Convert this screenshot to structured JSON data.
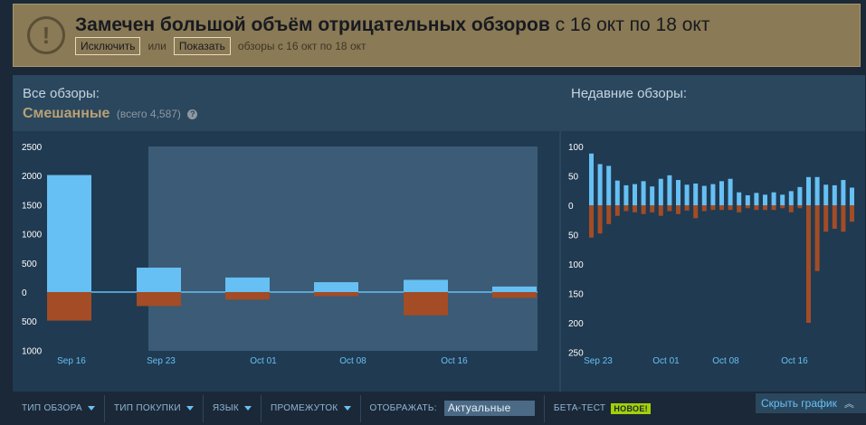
{
  "alert": {
    "title": "Замечен большой объём отрицательных обзоров",
    "dates": "с 16 окт по 18 окт",
    "exclude_label": "Исключить",
    "or_label": "или",
    "show_label": "Показать",
    "desc": "обзоры с 16 окт по 18 окт",
    "icon": "exclamation-icon"
  },
  "all_reviews": {
    "label": "Все обзоры:",
    "summary": "Смешанные",
    "total": "(всего 4,587)"
  },
  "recent_reviews": {
    "label": "Недавние обзоры:"
  },
  "colors": {
    "positive": "#66c0f4",
    "negative": "#a34c25",
    "summary": "#b9a074",
    "beta": "#a4d007"
  },
  "chart_data": [
    {
      "type": "bar",
      "name": "all-reviews",
      "y_ticks": [
        "2500",
        "2000",
        "1500",
        "1000",
        "500",
        "0",
        "500",
        "1000"
      ],
      "x_tick_labels": [
        "Sep 16",
        "Sep 23",
        "Oct 01",
        "Oct 08",
        "Oct 16"
      ],
      "categories": [
        "Sep 16",
        "Sep 23",
        "Oct 01",
        "Oct 08",
        "Oct 16",
        ""
      ],
      "series": [
        {
          "values": [
            2010,
            420,
            250,
            170,
            210,
            95
          ]
        },
        {
          "values": [
            -490,
            -240,
            -130,
            -70,
            -400,
            -100
          ]
        }
      ],
      "ylim": [
        -1000,
        2500
      ]
    },
    {
      "type": "bar",
      "name": "recent-reviews",
      "y_ticks": [
        "100",
        "50",
        "0",
        "50",
        "100",
        "150",
        "200",
        "250"
      ],
      "x_tick_labels": [
        "Sep 23",
        "Oct 01",
        "Oct 08",
        "Oct 16"
      ],
      "series": [
        {
          "values": [
            88,
            70,
            67,
            42,
            34,
            36,
            41,
            32,
            45,
            51,
            43,
            35,
            37,
            33,
            36,
            41,
            45,
            22,
            17,
            21,
            18,
            22,
            18,
            24,
            31,
            48,
            48,
            35,
            34,
            43,
            30
          ]
        },
        {
          "values": [
            -55,
            -48,
            -32,
            -18,
            -10,
            -12,
            -15,
            -12,
            -18,
            -10,
            -15,
            -9,
            -22,
            -10,
            -8,
            -8,
            -8,
            -12,
            -5,
            -8,
            -8,
            -8,
            -5,
            -12,
            -5,
            -200,
            -112,
            -45,
            -40,
            -45,
            -28
          ]
        }
      ],
      "ylim": [
        -250,
        100
      ]
    }
  ],
  "filters": {
    "review_type": "ТИП ОБЗОРА",
    "purchase_type": "ТИП ПОКУПКИ",
    "language": "ЯЗЫК",
    "period": "ПРОМЕЖУТОК",
    "display_label": "ОТОБРАЖАТЬ:",
    "display_value": "Актуальные",
    "beta_label": "БЕТА-ТЕСТ",
    "beta_badge": "НОВОЕ!",
    "hide_graph": "Скрыть график"
  }
}
